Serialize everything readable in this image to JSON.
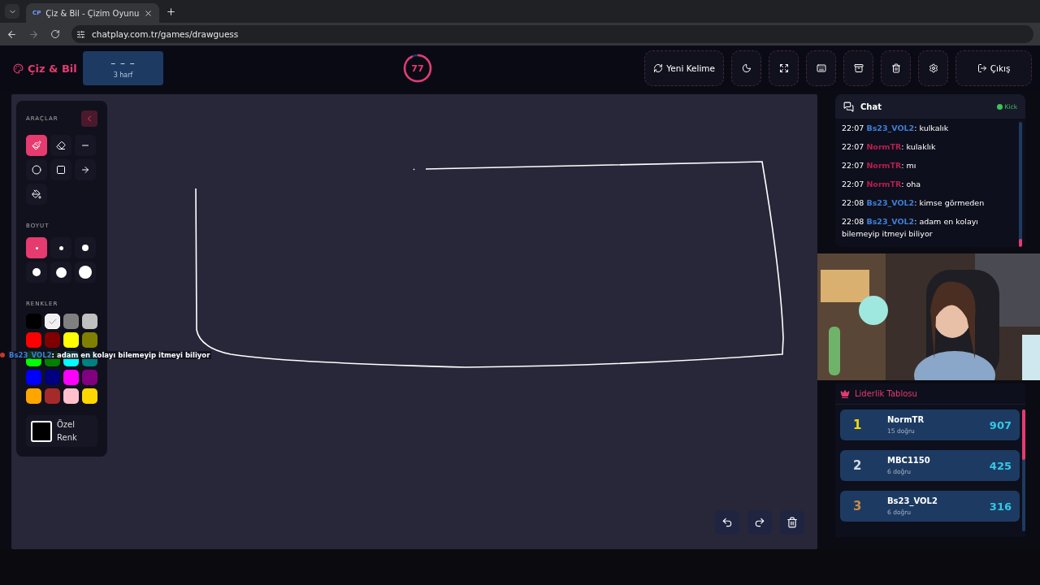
{
  "browser": {
    "tab": {
      "favicon": "CP",
      "title": "Çiz & Bil - Çizim Oyunu"
    },
    "url": "chatplay.com.tr/games/drawguess"
  },
  "header": {
    "logo": "Çiz & Bil",
    "word": {
      "hint": "– – –",
      "letters": "3 harf"
    },
    "timer": {
      "value": "77",
      "level": 0.93
    },
    "buttons": [
      {
        "kind": "refresh",
        "label": "Yeni Kelime"
      },
      {
        "kind": "moon"
      },
      {
        "kind": "expand"
      },
      {
        "kind": "keyboard"
      },
      {
        "kind": "archive"
      },
      {
        "kind": "trash"
      },
      {
        "kind": "settings"
      },
      {
        "kind": "logout",
        "label": "Çıkış"
      }
    ]
  },
  "palette": {
    "tools_title": "ARAÇLAR",
    "tools": [
      {
        "kind": "brush",
        "selected": true
      },
      {
        "kind": "eraser",
        "selected": false
      },
      {
        "kind": "line",
        "selected": false
      },
      {
        "kind": "circle",
        "selected": false
      },
      {
        "kind": "rectangle",
        "selected": false
      },
      {
        "kind": "arrow",
        "selected": false
      },
      {
        "kind": "fill",
        "selected": false
      }
    ],
    "size_title": "BOYUT",
    "sizes": [
      {
        "selected": true
      },
      {
        "selected": false
      },
      {
        "selected": false
      },
      {
        "selected": false
      },
      {
        "selected": false
      },
      {
        "selected": false
      }
    ],
    "colors_title": "RENKLER",
    "colors": [
      {
        "color": "#000000",
        "selected": false
      },
      {
        "color": "#f0f0f0",
        "selected": true
      },
      {
        "color": "#808080",
        "selected": false
      },
      {
        "color": "#c0c0c0",
        "selected": false
      },
      {
        "color": "#ff0000",
        "selected": false
      },
      {
        "color": "#800000",
        "selected": false
      },
      {
        "color": "#ffff00",
        "selected": false
      },
      {
        "color": "#808000",
        "selected": false
      },
      {
        "color": "#00ff00",
        "selected": false
      },
      {
        "color": "#008000",
        "selected": false
      },
      {
        "color": "#00ffff",
        "selected": false
      },
      {
        "color": "#008080",
        "selected": false
      },
      {
        "color": "#0000ff",
        "selected": false
      },
      {
        "color": "#000080",
        "selected": false
      },
      {
        "color": "#ff00ff",
        "selected": false
      },
      {
        "color": "#800080",
        "selected": false
      },
      {
        "color": "#ffa500",
        "selected": false
      },
      {
        "color": "#a52a2a",
        "selected": false
      },
      {
        "color": "#ffc0cb",
        "selected": false
      },
      {
        "color": "#ffd700",
        "selected": false
      }
    ],
    "custom": {
      "line1": "Özel",
      "line2": "Renk"
    }
  },
  "floating_message": {
    "user": "Bs23_VOL2",
    "text": ": adam en kolayı bilemeyip itmeyi biliyor"
  },
  "chat": {
    "title": "Chat",
    "source": "Kick",
    "messages": [
      {
        "time": "22:07",
        "user": "Bs23_VOL2",
        "color": "#3d7fd6",
        "text": ": kulkalık"
      },
      {
        "time": "22:07",
        "user": "NormTR",
        "color": "#b5204f",
        "text": ": kulaklık"
      },
      {
        "time": "22:07",
        "user": "NormTR",
        "color": "#b5204f",
        "text": ": mı"
      },
      {
        "time": "22:07",
        "user": "NormTR",
        "color": "#b5204f",
        "text": ": oha"
      },
      {
        "time": "22:08",
        "user": "Bs23_VOL2",
        "color": "#3d7fd6",
        "text": ": kimse görmeden"
      },
      {
        "time": "22:08",
        "user": "Bs23_VOL2",
        "color": "#3d7fd6",
        "text": ": adam en kolayı bilemeyip itmeyi biliyor"
      }
    ]
  },
  "leaderboard": {
    "title": "Liderlik Tablosu",
    "players": [
      {
        "rank": "1",
        "color": "#f5d90a",
        "name": "NormTR",
        "correct": "15 doğru",
        "score": "907"
      },
      {
        "rank": "2",
        "color": "#d4dae4",
        "name": "MBC1150",
        "correct": "6 doğru",
        "score": "425"
      },
      {
        "rank": "3",
        "color": "#c98a4a",
        "name": "Bs23_VOL2",
        "correct": "6 doğru",
        "score": "316"
      }
    ]
  }
}
